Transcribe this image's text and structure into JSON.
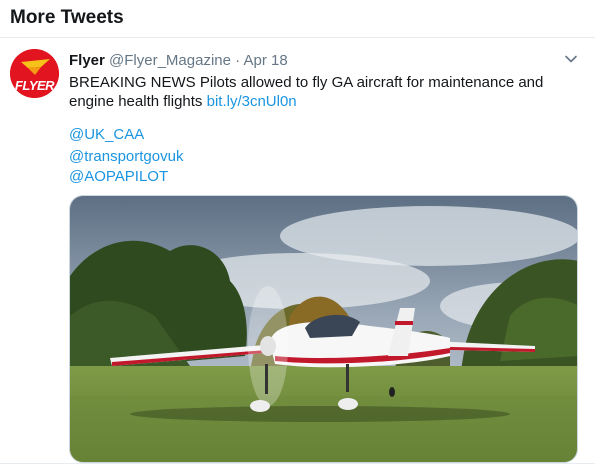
{
  "section": {
    "title": "More Tweets"
  },
  "tweet": {
    "author_name": "Flyer",
    "handle": "@Flyer_Magazine",
    "separator": "·",
    "date": "Apr 18",
    "avatar_text": "FLYER",
    "text_line1": "BREAKING NEWS Pilots allowed to fly GA aircraft for maintenance and",
    "text_line2": "engine health flights",
    "link": "bit.ly/3cnUl0n",
    "mentions": [
      "@UK_CAA",
      "@transportgovuk",
      "@AOPAPILOT"
    ],
    "menu_icon": "chevron-down-icon",
    "media_icon": "aircraft-photo"
  },
  "colors": {
    "link": "#1b95e0",
    "brand": "#e1141f"
  }
}
